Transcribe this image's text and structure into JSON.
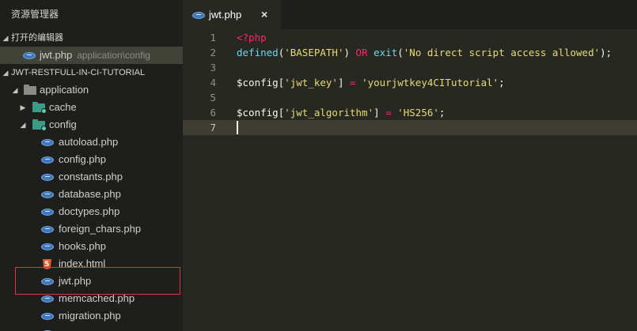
{
  "sidebar": {
    "title": "资源管理器",
    "open_editors": {
      "label": "打开的编辑器",
      "items": [
        {
          "name": "jwt.php",
          "path": "application\\config"
        }
      ]
    },
    "project": {
      "label": "JWT-RESTFULL-IN-CI-TUTORIAL",
      "tree": {
        "application": "application",
        "cache": "cache",
        "config": "config",
        "files": [
          "autoload.php",
          "config.php",
          "constants.php",
          "database.php",
          "doctypes.php",
          "foreign_chars.php",
          "hooks.php",
          "index.html",
          "jwt.php",
          "memcached.php",
          "migration.php"
        ]
      }
    }
  },
  "editor": {
    "tab": {
      "label": "jwt.php",
      "close": "×"
    },
    "lines": [
      {
        "n": "1",
        "tokens": [
          {
            "t": "<?php",
            "c": "tag"
          }
        ]
      },
      {
        "n": "2",
        "tokens": [
          {
            "t": "defined",
            "c": "fn"
          },
          {
            "t": "(",
            "c": "punc"
          },
          {
            "t": "'BASEPATH'",
            "c": "str"
          },
          {
            "t": ") ",
            "c": "punc"
          },
          {
            "t": "OR",
            "c": "op"
          },
          {
            "t": " ",
            "c": "punc"
          },
          {
            "t": "exit",
            "c": "fn"
          },
          {
            "t": "(",
            "c": "punc"
          },
          {
            "t": "'No direct script access allowed'",
            "c": "str"
          },
          {
            "t": ");",
            "c": "punc"
          }
        ]
      },
      {
        "n": "3",
        "tokens": []
      },
      {
        "n": "4",
        "tokens": [
          {
            "t": "$config",
            "c": "var"
          },
          {
            "t": "[",
            "c": "punc"
          },
          {
            "t": "'jwt_key'",
            "c": "str"
          },
          {
            "t": "] ",
            "c": "punc"
          },
          {
            "t": "=",
            "c": "op"
          },
          {
            "t": " ",
            "c": "punc"
          },
          {
            "t": "'yourjwtkey4CITutorial'",
            "c": "str"
          },
          {
            "t": ";",
            "c": "punc"
          }
        ]
      },
      {
        "n": "5",
        "tokens": []
      },
      {
        "n": "6",
        "tokens": [
          {
            "t": "$config",
            "c": "var"
          },
          {
            "t": "[",
            "c": "punc"
          },
          {
            "t": "'jwt_algorithm'",
            "c": "str"
          },
          {
            "t": "] ",
            "c": "punc"
          },
          {
            "t": "=",
            "c": "op"
          },
          {
            "t": " ",
            "c": "punc"
          },
          {
            "t": "'HS256'",
            "c": "str"
          },
          {
            "t": ";",
            "c": "punc"
          }
        ]
      },
      {
        "n": "7",
        "tokens": []
      }
    ],
    "current_line": "7"
  },
  "colors": {
    "sidebar_bg": "#1e1f1c",
    "editor_bg": "#272822",
    "current_line_bg": "#3e3d32",
    "highlight_border": "#d23b3b",
    "keyword": "#f92672",
    "function": "#66d9ef",
    "string": "#e6db74"
  }
}
